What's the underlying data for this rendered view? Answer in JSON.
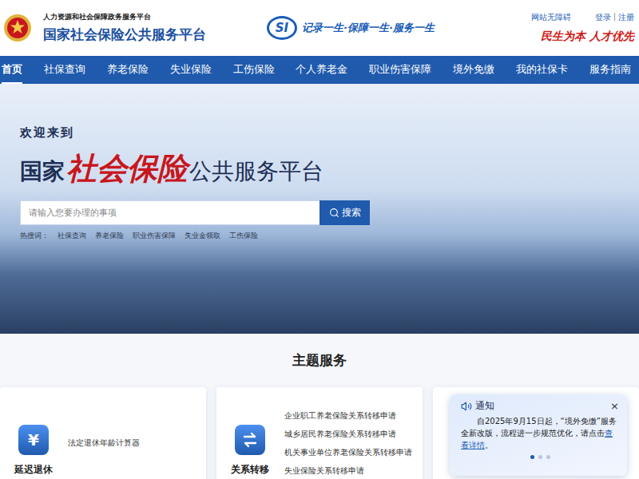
{
  "header": {
    "ministry": "人力资源和社会保障政务服务平台",
    "title": "国家社会保险公共服务平台",
    "logo": "SI",
    "slogan": "记录一生·保障一生·服务一生",
    "accessibility": "网站无障碍",
    "login": "登录",
    "separator": "|",
    "register": "注册",
    "motto": "民生为本 人才优先"
  },
  "nav": [
    {
      "label": "首页",
      "selected": true
    },
    {
      "label": "社保查询",
      "selected": false
    },
    {
      "label": "养老保险",
      "selected": false
    },
    {
      "label": "失业保险",
      "selected": false
    },
    {
      "label": "工伤保险",
      "selected": false
    },
    {
      "label": "个人养老金",
      "selected": false
    },
    {
      "label": "职业伤害保障",
      "selected": false
    },
    {
      "label": "境外免缴",
      "selected": false
    },
    {
      "label": "我的社保卡",
      "selected": false
    },
    {
      "label": "服务指南",
      "selected": false
    }
  ],
  "hero": {
    "welcome": "欢迎来到",
    "title_prefix": "国家",
    "title_highlight": "社会保险",
    "title_suffix": "公共服务平台",
    "search": {
      "placeholder": "请输入您要办理的事项",
      "button": "搜索"
    },
    "hot_label": "热搜词：",
    "hot": [
      "社保查询",
      "养老保险",
      "职业伤害保障",
      "失业金领取",
      "工伤保险"
    ]
  },
  "section": {
    "title": "主题服务"
  },
  "cards": [
    {
      "label": "延迟退休",
      "kind": "glyph",
      "glyph": "¥",
      "links": [
        "法定退休年龄计算器"
      ]
    },
    {
      "label": "关系转移",
      "kind": "transfer",
      "glyph": "",
      "links": [
        "企业职工养老保险关系转移申请",
        "城乡居民养老保险关系转移申请",
        "机关事业单位养老保险关系转移申请",
        "失业保险关系转移申请"
      ]
    }
  ],
  "notice": {
    "title": "通知",
    "close": "×",
    "text": "自2025年9月15日起，“境外免缴”服务全新改版，流程进一步规范优化，请点击",
    "link": "查看详情",
    "end": "。",
    "pages": [
      {
        "selected": true
      },
      {
        "selected": false
      },
      {
        "selected": false
      }
    ]
  }
}
